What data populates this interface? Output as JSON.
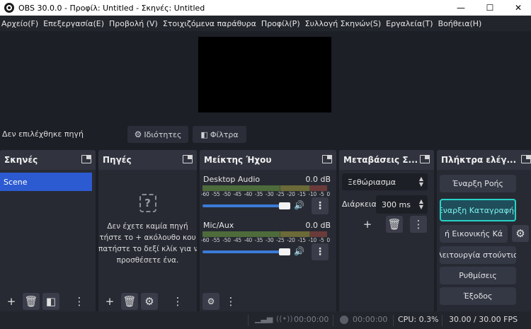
{
  "window": {
    "title": "OBS 30.0.0 - Προφίλ: Untitled - Σκηνές: Untitled",
    "minimize": "—",
    "maximize": "☐",
    "close": "✕"
  },
  "menu": [
    "Αρχείο(F)",
    "Επεξεργασία(E)",
    "Προβολή (V)",
    "Στοιχιζόμενα παράθυρα",
    "Προφίλ(P)",
    "Συλλογή Σκηνών(S)",
    "Εργαλεία(T)",
    "Βοήθεια(H)"
  ],
  "source_bar": {
    "no_source": "Δεν επιλέχθηκε πηγή",
    "properties": "Ιδιότητες",
    "filters": "Φίλτρα"
  },
  "scenes": {
    "title": "Σκηνές",
    "items": [
      "Scene"
    ]
  },
  "sources": {
    "title": "Πηγές",
    "empty_icon": "?",
    "empty_lines": [
      "Δεν έχετε καμία πηγή",
      "τήστε το + ακόλουθο κου",
      "πατήστε το δεξί κλίκ για ν",
      "προσθέσετε ένα."
    ]
  },
  "mixer": {
    "title": "Μείκτης Ήχου",
    "ticks": [
      "-60",
      "-55",
      "-50",
      "-45",
      "-40",
      "-35",
      "-30",
      "-25",
      "-20",
      "-15",
      "-10",
      "-5",
      "0"
    ],
    "channels": [
      {
        "name": "Desktop Audio",
        "db": "0.0 dB",
        "volume": 1.0
      },
      {
        "name": "Mic/Aux",
        "db": "0.0 dB",
        "volume": 1.0
      }
    ]
  },
  "transitions": {
    "title": "Μεταβάσεις Σ...",
    "type": "Ξεθώριασμα",
    "duration_label": "Διάρκεια",
    "duration_value": "300 ms"
  },
  "controls": {
    "title": "Πλήκτρα ελέγ...",
    "buttons": [
      "Έναρξη Ροής",
      "Έναρξη Καταγραφής",
      "ή Εικονικής Κά",
      "λειτουργία στούντιο",
      "Ρυθμίσεις",
      "Έξοδος"
    ]
  },
  "status": {
    "stream_time": "00:00:00",
    "rec_time": "00:00:00",
    "cpu": "CPU: 0.3%",
    "fps": "30.00 / 30.00 FPS"
  },
  "colors": {
    "accent": "#2c5bd1",
    "record_active": "#2ad1c9"
  }
}
